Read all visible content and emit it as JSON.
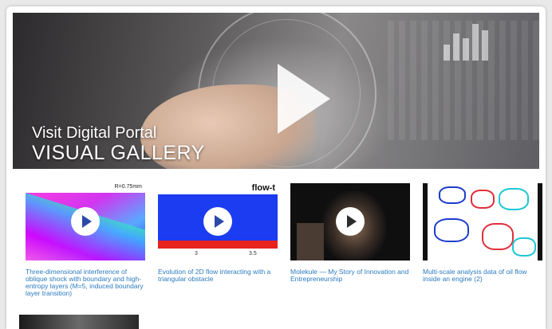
{
  "hero": {
    "subtitle": "Visit Digital Portal",
    "title": "VISUAL GALLERY",
    "play_icon": "play-icon"
  },
  "thumbnails": [
    {
      "caption": "Three-dimensional interference of oblique shock with boundary and high-entropy layers (M=5, induced boundary layer transition)",
      "label": "R=0.75mm"
    },
    {
      "caption": "Evolution of 2D flow interacting with a triangular obstacle",
      "label": "flow-t",
      "ticks": [
        "3",
        "3.5"
      ]
    },
    {
      "caption": "Molekule — My Story of Innovation and Entrepreneurship"
    },
    {
      "caption": "Multi-scale analysis data of oil flow inside an engine (2)"
    }
  ],
  "colors": {
    "caption": "#2c7bbf",
    "play_blue": "#2b4aa8"
  }
}
